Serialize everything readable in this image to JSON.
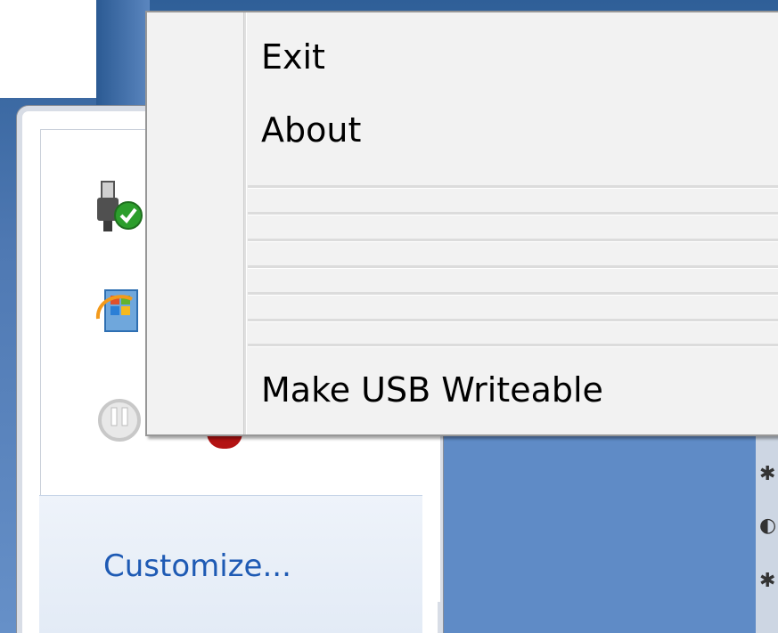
{
  "context_menu": {
    "items": [
      {
        "label": "Exit"
      },
      {
        "label": "About"
      },
      {
        "label": "Make USB Writeable"
      }
    ],
    "separator_count": 6
  },
  "tray_popup": {
    "customize_label": "Customize...",
    "icons": [
      "usb-safe-remove-icon",
      "windows-update-icon",
      "power-icon"
    ]
  },
  "colors": {
    "menu_background": "#f2f2f2",
    "link": "#1e5ab4",
    "desktop_blue": "#5f8bc6"
  }
}
